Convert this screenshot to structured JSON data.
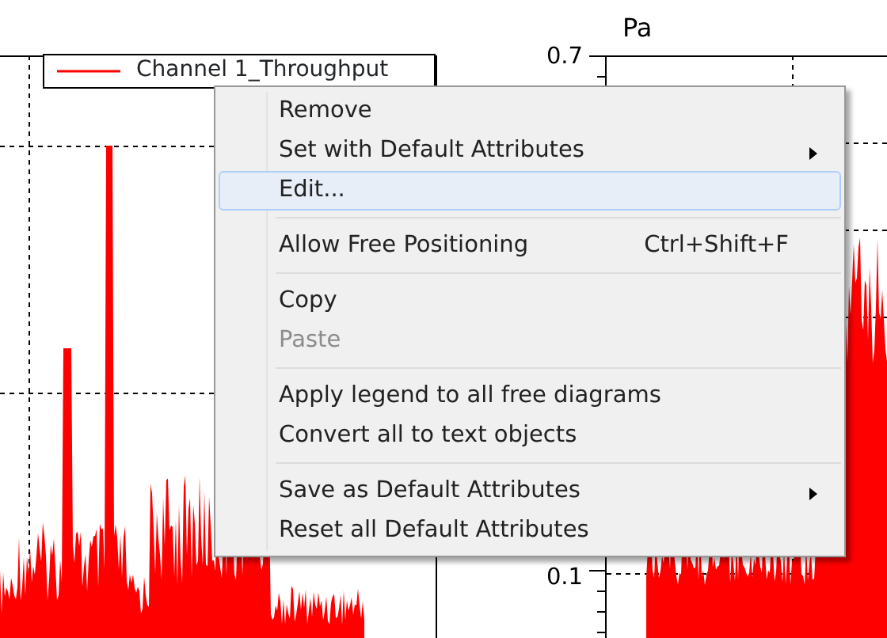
{
  "plot_left": {
    "legend": {
      "label": "Channel 1_Throughput",
      "color": "#ff0000"
    }
  },
  "plot_right": {
    "unit": "Pa",
    "y_tick_labels": [
      "0.7",
      "0.1"
    ]
  },
  "context_menu": {
    "items": [
      {
        "kind": "item",
        "label": "Remove",
        "submenu": false,
        "highlighted": false,
        "disabled": false
      },
      {
        "kind": "item",
        "label": "Set with Default Attributes",
        "submenu": true,
        "highlighted": false,
        "disabled": false
      },
      {
        "kind": "item",
        "label": "Edit...",
        "submenu": false,
        "highlighted": true,
        "disabled": false
      },
      {
        "kind": "separator"
      },
      {
        "kind": "item",
        "label": "Allow Free Positioning",
        "shortcut": "Ctrl+Shift+F",
        "submenu": false,
        "highlighted": false,
        "disabled": false
      },
      {
        "kind": "separator"
      },
      {
        "kind": "item",
        "label": "Copy",
        "submenu": false,
        "highlighted": false,
        "disabled": false
      },
      {
        "kind": "item",
        "label": "Paste",
        "submenu": false,
        "highlighted": false,
        "disabled": true
      },
      {
        "kind": "separator"
      },
      {
        "kind": "item",
        "label": "Apply legend to all free diagrams",
        "submenu": false,
        "highlighted": false,
        "disabled": false
      },
      {
        "kind": "item",
        "label": "Convert all to text objects",
        "submenu": false,
        "highlighted": false,
        "disabled": false
      },
      {
        "kind": "separator"
      },
      {
        "kind": "item",
        "label": "Save as Default Attributes",
        "submenu": true,
        "highlighted": false,
        "disabled": false
      },
      {
        "kind": "item",
        "label": "Reset all Default Attributes",
        "submenu": false,
        "highlighted": false,
        "disabled": false
      }
    ]
  }
}
